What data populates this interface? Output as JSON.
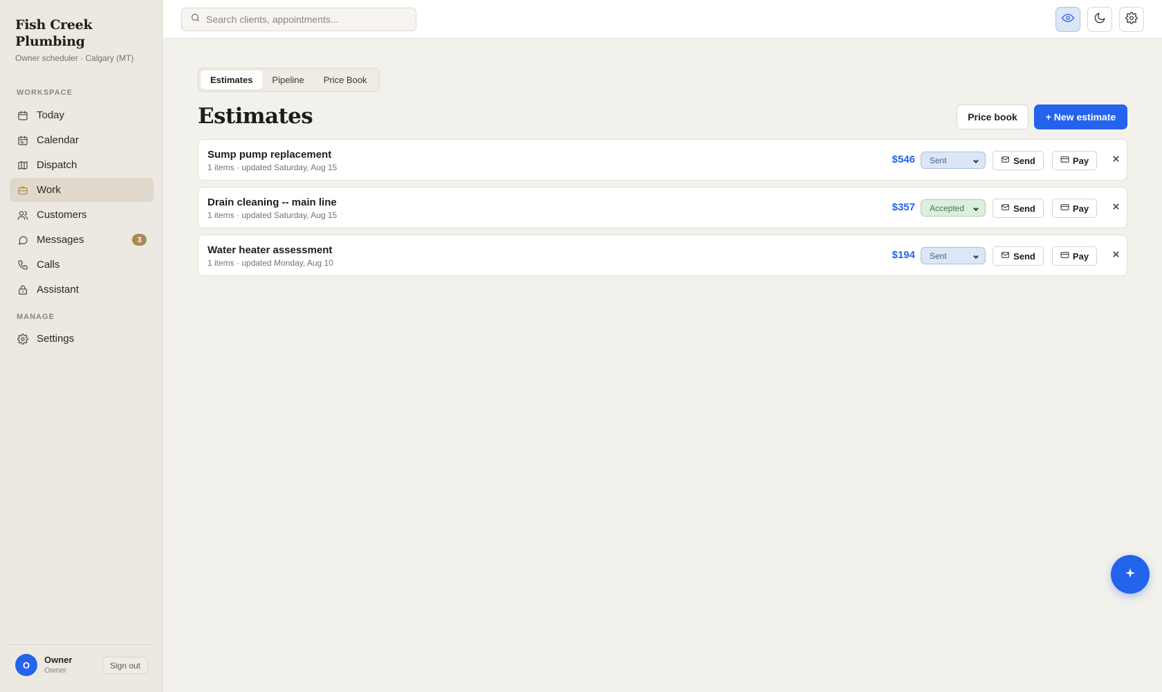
{
  "brand": {
    "name": "Fish Creek Plumbing",
    "subtitle": "Owner scheduler · Calgary (MT)"
  },
  "sidebar": {
    "workspace_label": "WORKSPACE",
    "manage_label": "MANAGE",
    "items": [
      {
        "label": "Today",
        "icon": "calendar-icon"
      },
      {
        "label": "Calendar",
        "icon": "calendar-list-icon"
      },
      {
        "label": "Dispatch",
        "icon": "map-icon"
      },
      {
        "label": "Work",
        "icon": "briefcase-icon",
        "active": true
      },
      {
        "label": "Customers",
        "icon": "users-icon"
      },
      {
        "label": "Messages",
        "icon": "message-icon",
        "badge": "3"
      },
      {
        "label": "Calls",
        "icon": "phone-icon"
      },
      {
        "label": "Assistant",
        "icon": "assistant-icon"
      }
    ],
    "manage_items": [
      {
        "label": "Settings",
        "icon": "gear-icon"
      }
    ],
    "user": {
      "initial": "O",
      "name": "Owner",
      "role": "Owner",
      "signout_label": "Sign out"
    }
  },
  "topbar": {
    "search_placeholder": "Search clients, appointments...",
    "buttons": [
      "eye-icon",
      "moon-icon",
      "gear-icon"
    ]
  },
  "main": {
    "tabs": [
      {
        "label": "Estimates",
        "active": true
      },
      {
        "label": "Pipeline"
      },
      {
        "label": "Price Book"
      }
    ],
    "title": "Estimates",
    "price_book_label": "Price book",
    "new_estimate_label": "+ New estimate",
    "send_label": "Send",
    "pay_label": "Pay",
    "estimates": [
      {
        "title": "Sump pump replacement",
        "meta": "1 items · updated Saturday, Aug 15",
        "amount": "$546",
        "status": "Sent"
      },
      {
        "title": "Drain cleaning -- main line",
        "meta": "1 items · updated Saturday, Aug 15",
        "amount": "$357",
        "status": "Accepted"
      },
      {
        "title": "Water heater assessment",
        "meta": "1 items · updated Monday, Aug 10",
        "amount": "$194",
        "status": "Sent"
      }
    ]
  },
  "colors": {
    "accent": "#2463eb",
    "gold": "#a98a52",
    "sent_bg": "#dbe6f6",
    "accepted_bg": "#dcefdf"
  }
}
